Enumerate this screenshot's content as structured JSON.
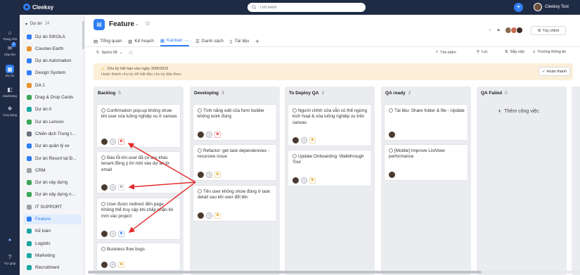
{
  "app": {
    "name": "Cleeksy"
  },
  "search": {
    "placeholder": "Tìm kiếm"
  },
  "user": {
    "name": "Cleeksy Test"
  },
  "rail": [
    {
      "label": "Trang chủ",
      "icon": "home-icon"
    },
    {
      "label": "Hộp thư",
      "icon": "inbox-icon",
      "badge": "2"
    },
    {
      "label": "Dự án",
      "icon": "projects-icon"
    },
    {
      "label": "Marketing",
      "icon": "marketing-icon"
    },
    {
      "label": "Ứng dụng",
      "icon": "apps-icon"
    },
    {
      "label": "Trợ giúp",
      "icon": "help-icon"
    }
  ],
  "sidebar": {
    "section": "Dự án",
    "count": "24",
    "items": [
      {
        "label": "Dự án SIKOLA",
        "color": "#2f7ef5"
      },
      {
        "label": "Counter-Earth",
        "color": "#e8912d"
      },
      {
        "label": "Dự án Automation",
        "color": "#2f7ef5"
      },
      {
        "label": "Design System",
        "color": "#2f7ef5"
      },
      {
        "label": "DA 1",
        "color": "#e8912d"
      },
      {
        "label": "Drag & Drop Cards",
        "color": "#3aa757"
      },
      {
        "label": "Dự án A",
        "color": "#1aa7a0"
      },
      {
        "label": "Dự án Lenovo",
        "color": "#3aa757"
      },
      {
        "label": "Chiến dịch Trung t...",
        "color": "#6b7280"
      },
      {
        "label": "Dự án quản lý xe",
        "color": "#2f7ef5"
      },
      {
        "label": "Dự án Resort tại Đ...",
        "color": "#2f7ef5"
      },
      {
        "label": "CRM",
        "color": "#9aa0a6"
      },
      {
        "label": "Dự án xây dựng",
        "color": "#3aa757"
      },
      {
        "label": "Dự án xây dựng nh...",
        "color": "#3aa757"
      },
      {
        "label": "IT SUPPORT",
        "color": "#9aa0a6"
      },
      {
        "label": "Feature",
        "color": "#2f7ef5"
      },
      {
        "label": "Kế toán",
        "color": "#1aa7a0"
      },
      {
        "label": "Logistic",
        "color": "#1aa7a0"
      },
      {
        "label": "Marketing",
        "color": "#1aa7a0"
      },
      {
        "label": "Recruitment",
        "color": "#1aa7a0"
      }
    ]
  },
  "header": {
    "title": "Feature",
    "customize": "Tùy chỉnh"
  },
  "tabs": [
    {
      "label": "Tổng quan"
    },
    {
      "label": "Kế hoạch"
    },
    {
      "label": "Kanban"
    },
    {
      "label": "Danh sách"
    },
    {
      "label": "Tài liệu"
    }
  ],
  "toolbar": {
    "sprint": "Sprint 08",
    "search": "Tìm kiếm",
    "filter": "Lọc",
    "sort": "Sắp xếp",
    "fields": "Trường thông tin"
  },
  "notice": {
    "line1": "Chu kỳ hết hạn vào ngày 30/6/2023",
    "line2": "Hoàn thành chu kỳ để bắt đầu chu kỳ tiếp theo.",
    "button": "Hoàn thành"
  },
  "columns": [
    {
      "name": "Backlog",
      "count": "5",
      "cards": [
        {
          "title": "Confirmation pop-up không show khi user xóa luồng nghiệp vụ ở canvas",
          "flag": "red"
        },
        {
          "title": "Báo lỗi khi user đã có acc khác tenant đồng ý lời mời vào dự án từ email",
          "flag": "gray"
        },
        {
          "title": "User được redirect đến page Không thể truy cập khi chấp nhận lời mời vào project",
          "flag": "blue"
        },
        {
          "title": "Business flow bugs",
          "flag": "yellow"
        }
      ]
    },
    {
      "name": "Developing",
      "count": "3",
      "cards": [
        {
          "title": "Tính năng edit của form builder không work đúng",
          "flag": "red"
        },
        {
          "title": "Refactor: get task dependencies - recursive issue",
          "flag": "yellow"
        },
        {
          "title": "Tên user không show đúng ở task detail sau khi user đổi tên",
          "flag": "yellow"
        }
      ]
    },
    {
      "name": "To Deploy QA",
      "count": "2",
      "cards": [
        {
          "title": "Người chỉnh sửa vẫn có thể ngừng kích hoạt & xóa luồng nghiệp vụ trên canvas",
          "flag": "yellow"
        },
        {
          "title": "Update Onboarding: Walkthrough Tour",
          "flag": "yellow"
        }
      ]
    },
    {
      "name": "QA ready",
      "count": "2",
      "cards": [
        {
          "title": "Tài liệu: Share folder & file - Update",
          "flag": "none"
        },
        {
          "title": "[Mobile] Improve ListView performance",
          "flag": "none"
        }
      ]
    },
    {
      "name": "QA Failed",
      "count": "0",
      "add_label": "Thêm công việc"
    }
  ]
}
